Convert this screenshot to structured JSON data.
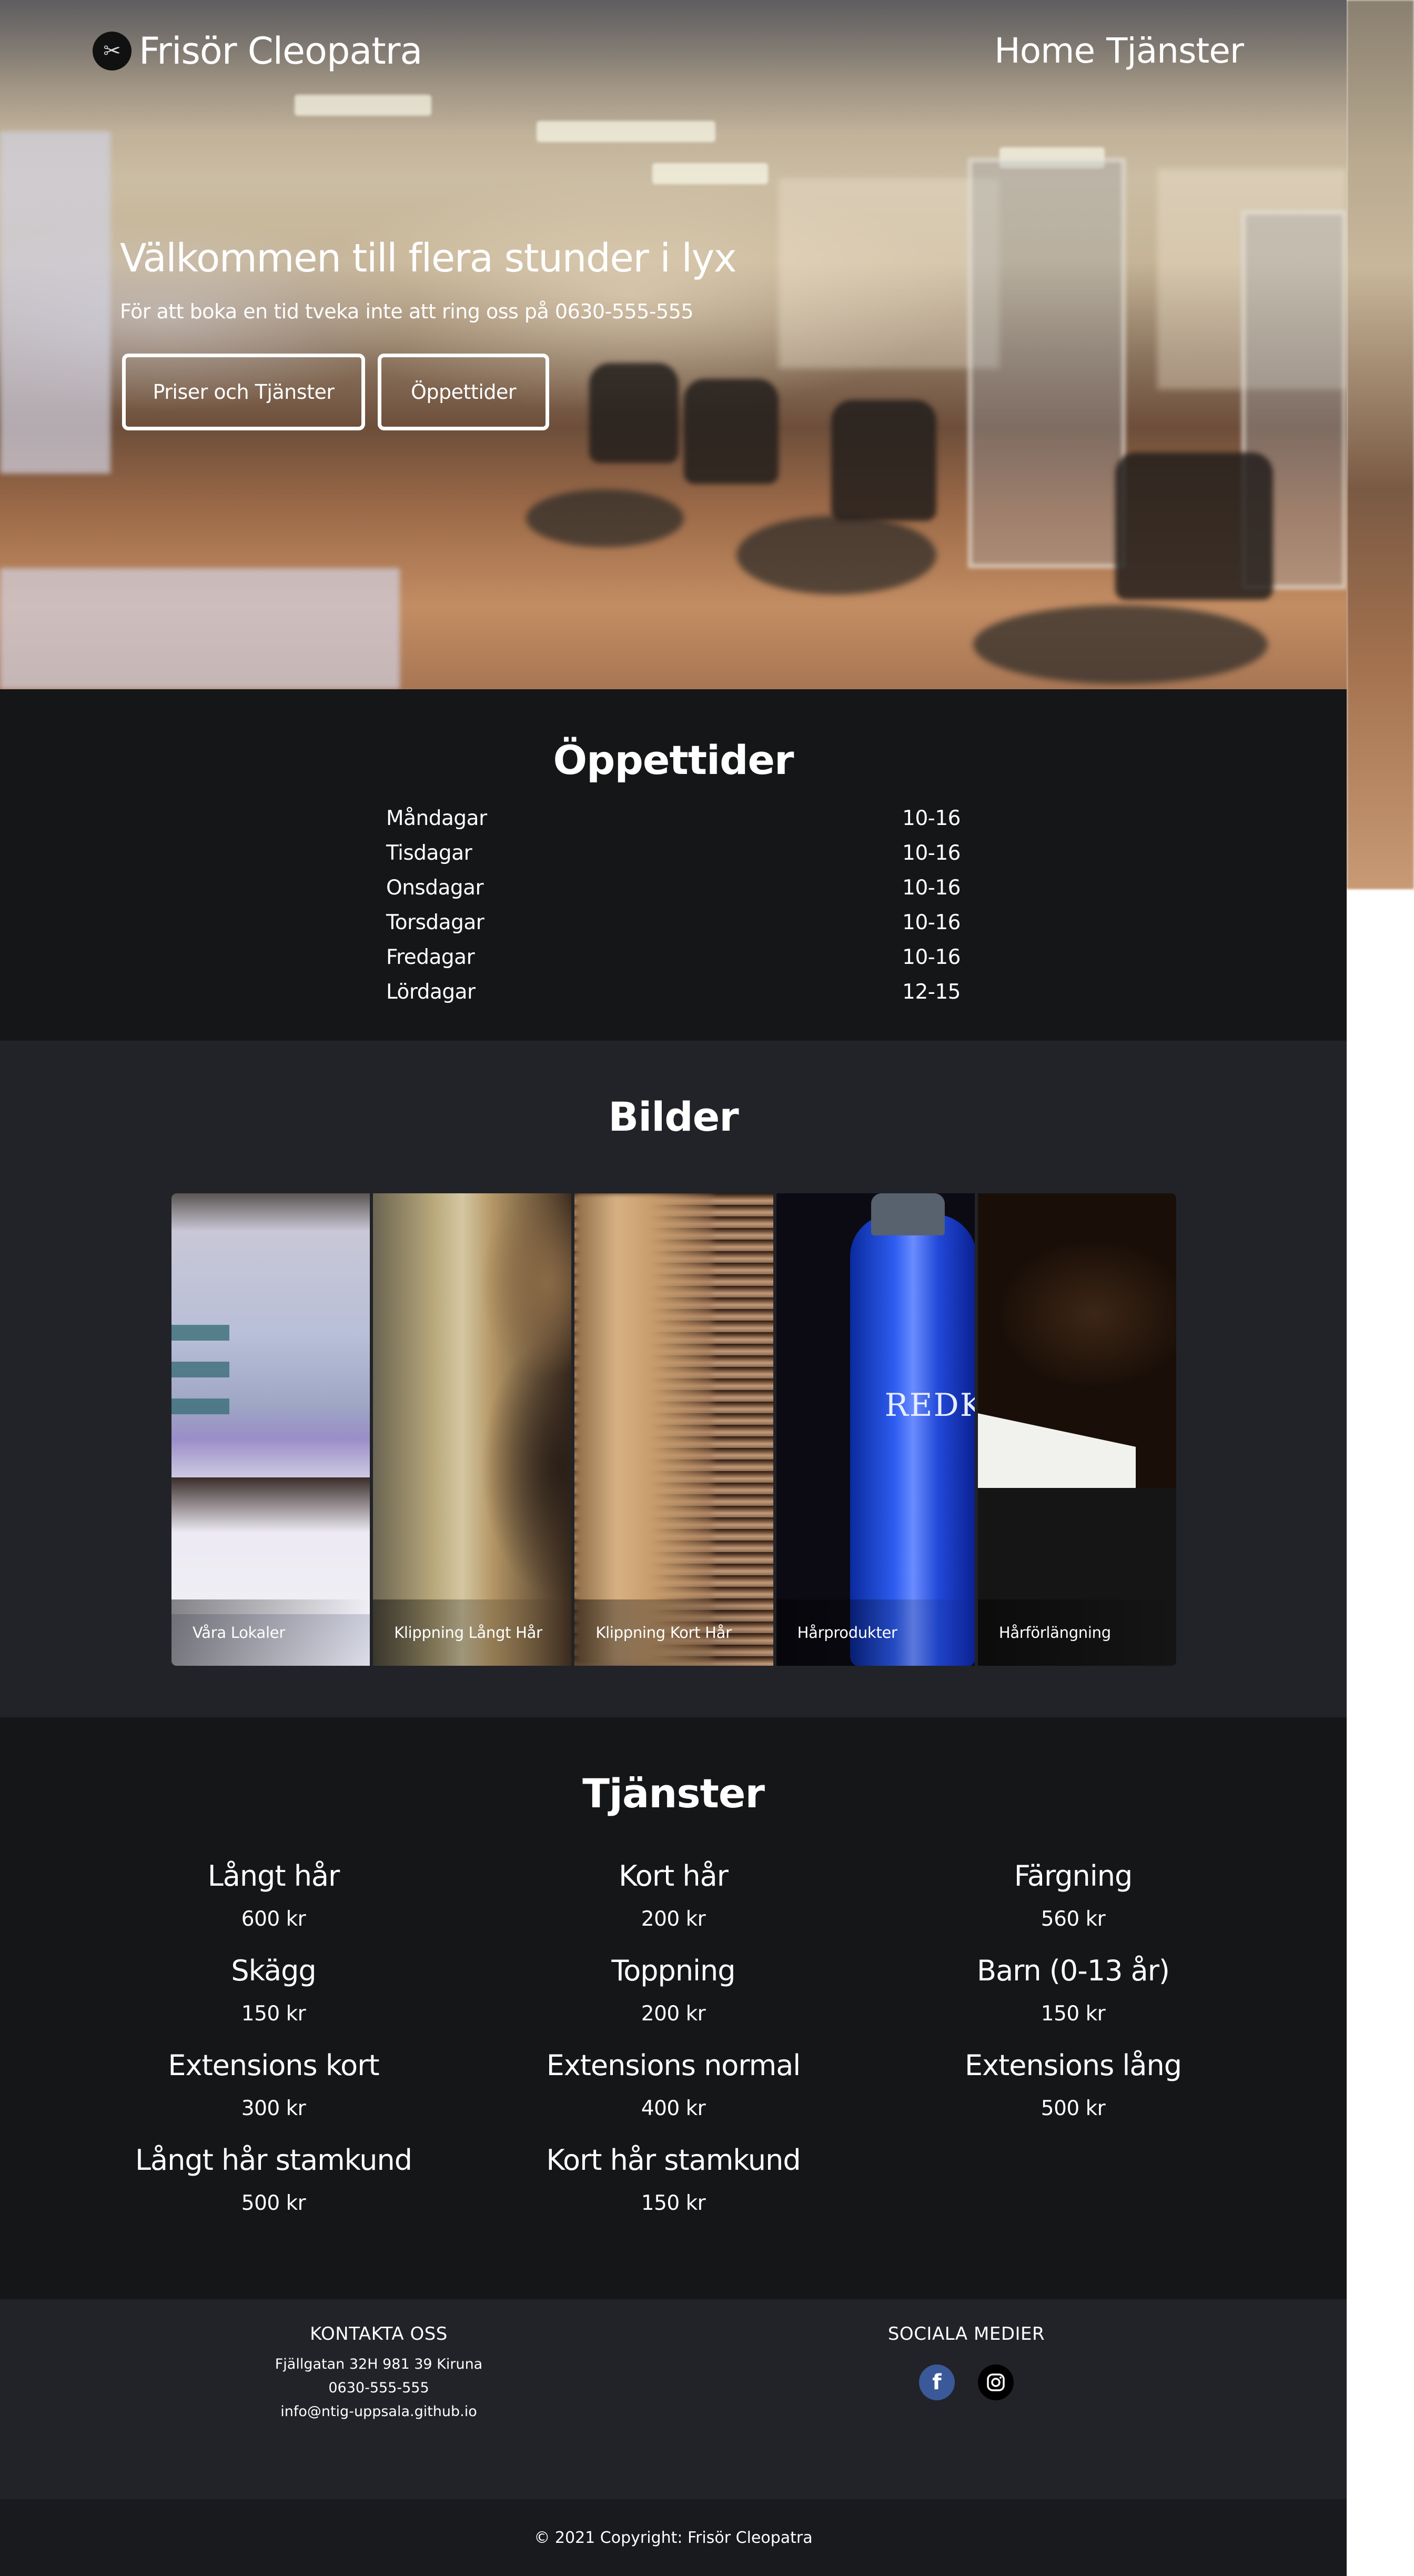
{
  "brand": {
    "name": "Frisör Cleopatra",
    "logo_icon": "scissors-icon"
  },
  "nav": {
    "home": "Home",
    "services": "Tjänster"
  },
  "hero": {
    "title": "Välkommen till flera stunder i lyx",
    "subtitle": "För att boka en tid tveka inte att ring oss på 0630-555-555",
    "button_prices": "Priser och Tjänster",
    "button_hours": "Öppettider"
  },
  "hours": {
    "title": "Öppettider",
    "rows": [
      {
        "day": "Måndagar",
        "time": "10-16"
      },
      {
        "day": "Tisdagar",
        "time": "10-16"
      },
      {
        "day": "Onsdagar",
        "time": "10-16"
      },
      {
        "day": "Torsdagar",
        "time": "10-16"
      },
      {
        "day": "Fredagar",
        "time": "10-16"
      },
      {
        "day": "Lördagar",
        "time": "12-15"
      }
    ]
  },
  "gallery": {
    "title": "Bilder",
    "tiles": [
      {
        "caption": "Våra Lokaler"
      },
      {
        "caption": "Klippning Långt Hår"
      },
      {
        "caption": "Klippning Kort Hår"
      },
      {
        "caption": "Hårprodukter"
      },
      {
        "caption": "Hårförlängning"
      }
    ],
    "bottle_label": "REDK"
  },
  "services": {
    "title": "Tjänster",
    "items": [
      {
        "name": "Långt hår",
        "price": "600 kr"
      },
      {
        "name": "Kort hår",
        "price": "200 kr"
      },
      {
        "name": "Färgning",
        "price": "560 kr"
      },
      {
        "name": "Skägg",
        "price": "150 kr"
      },
      {
        "name": "Toppning",
        "price": "200 kr"
      },
      {
        "name": "Barn (0-13 år)",
        "price": "150 kr"
      },
      {
        "name": "Extensions kort",
        "price": "300 kr"
      },
      {
        "name": "Extensions normal",
        "price": "400 kr"
      },
      {
        "name": "Extensions lång",
        "price": "500 kr"
      },
      {
        "name": "Långt hår stamkund",
        "price": "500 kr"
      },
      {
        "name": "Kort hår stamkund",
        "price": "150 kr"
      }
    ]
  },
  "footer": {
    "contact_title": "KONTAKTA OSS",
    "address": "Fjällgatan 32H 981 39 Kiruna",
    "phone": "0630-555-555",
    "email": "info@ntig-uppsala.github.io",
    "social_title": "SOCIALA MEDIER",
    "facebook_icon": "facebook-icon",
    "instagram_icon": "instagram-icon",
    "copyright": "© 2021 Copyright: Frisör Cleopatra"
  },
  "colors": {
    "dark_section": "#151617",
    "gallery_section": "#212328",
    "facebook": "#3b5998"
  }
}
